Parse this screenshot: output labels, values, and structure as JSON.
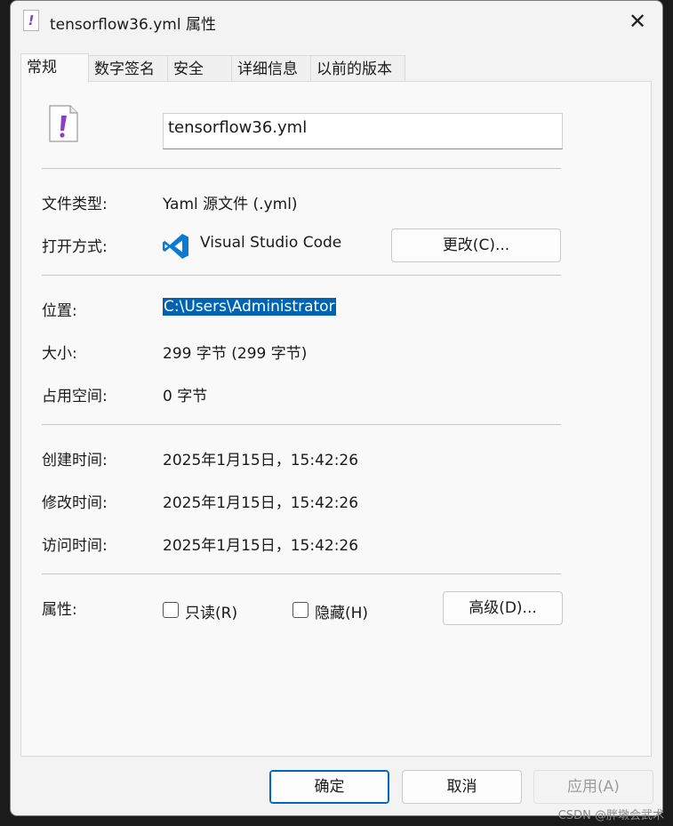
{
  "window": {
    "title": "tensorflow36.yml 属性",
    "close_symbol": "✕",
    "file_icon_glyph": "!"
  },
  "tabs": [
    {
      "label": "常规"
    },
    {
      "label": "数字签名"
    },
    {
      "label": "安全"
    },
    {
      "label": "详细信息"
    },
    {
      "label": "以前的版本"
    }
  ],
  "general": {
    "file_name": "tensorflow36.yml",
    "type_label": "文件类型:",
    "type_value": "Yaml 源文件 (.yml)",
    "open_with_label": "打开方式:",
    "open_with_app": "Visual Studio Code",
    "change_button": "更改(C)...",
    "location_label": "位置:",
    "location_value": "C:\\Users\\Administrator",
    "size_label": "大小:",
    "size_value": "299 字节 (299 字节)",
    "size_on_disk_label": "占用空间:",
    "size_on_disk_value": "0 字节",
    "created_label": "创建时间:",
    "created_value": "2025年1月15日，15:42:26",
    "modified_label": "修改时间:",
    "modified_value": "2025年1月15日，15:42:26",
    "accessed_label": "访问时间:",
    "accessed_value": "2025年1月15日，15:42:26",
    "attributes_label": "属性:",
    "readonly_label": "只读(R)",
    "hidden_label": "隐藏(H)",
    "advanced_button": "高级(D)..."
  },
  "footer": {
    "ok": "确定",
    "cancel": "取消",
    "apply": "应用(A)"
  },
  "watermark": "CSDN @胖墩会武术",
  "colors": {
    "selection": "#0063b1",
    "vscode_blue": "#0a7ad4",
    "yaml_icon_purple": "#8a3fc6"
  }
}
